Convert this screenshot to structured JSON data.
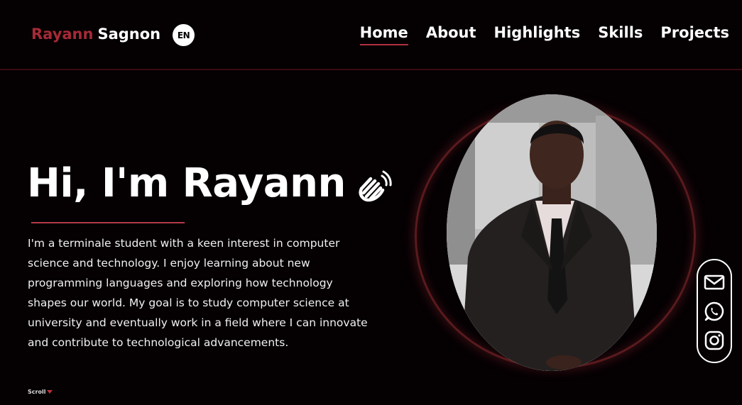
{
  "header": {
    "logo_first": "Rayann",
    "logo_last": "Sagnon",
    "language": "EN",
    "nav": [
      {
        "label": "Home",
        "active": true
      },
      {
        "label": "About",
        "active": false
      },
      {
        "label": "Highlights",
        "active": false
      },
      {
        "label": "Skills",
        "active": false
      },
      {
        "label": "Projects",
        "active": false
      }
    ]
  },
  "hero": {
    "title": "Hi, I'm Rayann",
    "description": "I'm a terminale student with a keen interest in computer science and technology. I enjoy learning about new programming languages and exploring how technology shapes our world. My goal is to study computer science at university and eventually work in a field where I can innovate and contribute to technological advancements.",
    "scroll_label": "Scroll"
  },
  "social": [
    {
      "icon": "mail-icon"
    },
    {
      "icon": "whatsapp-icon"
    },
    {
      "icon": "instagram-icon"
    }
  ],
  "colors": {
    "background": "#050103",
    "accent": "#a52a36",
    "text": "#ffffff"
  }
}
